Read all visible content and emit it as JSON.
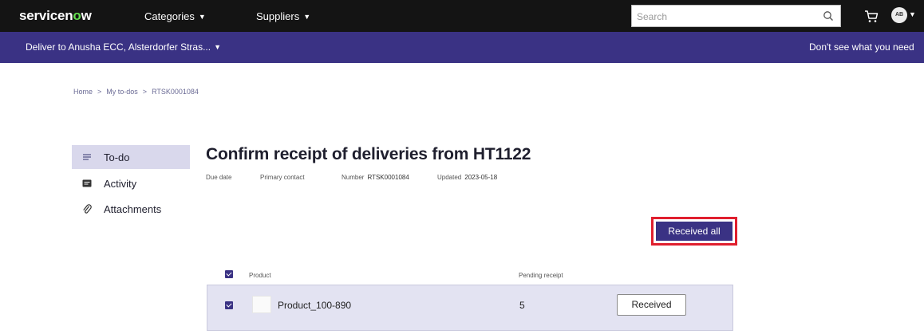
{
  "header": {
    "logo_text_a": "servicen",
    "logo_text_o": "o",
    "logo_text_b": "w",
    "menus": [
      {
        "label": "Categories"
      },
      {
        "label": "Suppliers"
      }
    ],
    "search": {
      "placeholder": "Search",
      "value": ""
    },
    "avatar_initials": "AB"
  },
  "subbar": {
    "deliver_to": "Deliver to Anusha ECC, Alsterdorfer Stras...",
    "help_text": "Don't see what you need"
  },
  "breadcrumb": [
    "Home",
    "My to-dos",
    "RTSK0001084"
  ],
  "sidenav": [
    {
      "label": "To-do",
      "icon": "list-icon",
      "active": true
    },
    {
      "label": "Activity",
      "icon": "activity-icon",
      "active": false
    },
    {
      "label": "Attachments",
      "icon": "paperclip-icon",
      "active": false
    }
  ],
  "main": {
    "title": "Confirm receipt of deliveries from HT1122",
    "meta": {
      "due_date_label": "Due date",
      "primary_contact_label": "Primary contact",
      "number_label": "Number",
      "number_value": "RTSK0001084",
      "updated_label": "Updated",
      "updated_value": "2023-05-18"
    },
    "received_all_label": "Received all",
    "table": {
      "columns": [
        "Product",
        "Pending receipt"
      ],
      "rows": [
        {
          "product": "Product_100-890",
          "pending": "5",
          "action_label": "Received",
          "checked": true
        }
      ],
      "select_all_checked": true
    }
  },
  "colors": {
    "topbar": "#141414",
    "subbar": "#3a3284",
    "accent": "#3a3284",
    "highlight_border": "#e01f2e",
    "row_bg": "#e3e3f2"
  }
}
